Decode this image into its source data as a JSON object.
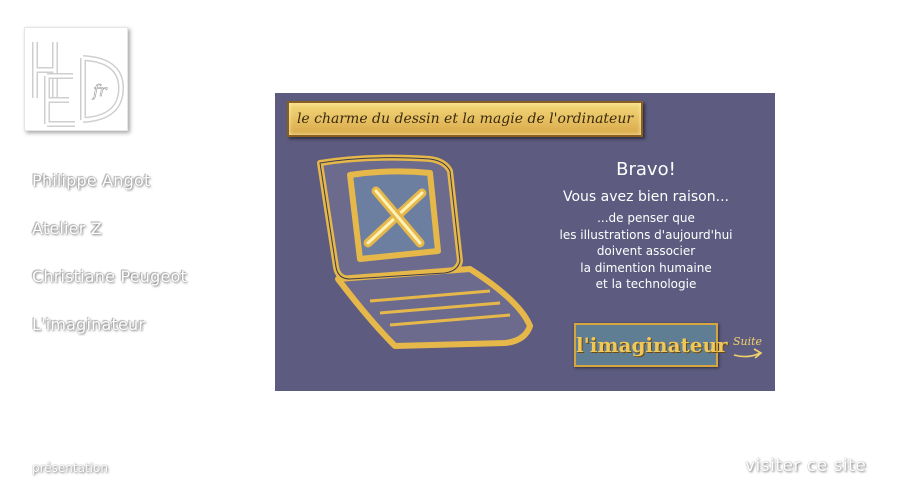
{
  "logo": {
    "letters": "HED",
    "suffix": "fr"
  },
  "nav": {
    "items": [
      {
        "label": "Philippe Angot"
      },
      {
        "label": "Atelier Z"
      },
      {
        "label": "Christiane Peugeot"
      },
      {
        "label": "L'imaginateur"
      }
    ]
  },
  "banner": {
    "tagline": "le charme du dessin et la magie de l'ordinateur",
    "headline": "Bravo!",
    "subheadline": "Vous avez bien raison...",
    "lines": [
      "...de penser que",
      "les illustrations d'aujourd'hui",
      "doivent associer",
      "la dimention humaine",
      "et la technologie"
    ],
    "brand": "l'imaginateur",
    "next": "Suite",
    "colors": {
      "background": "#5d5c80",
      "gold": "#e6b84a"
    }
  },
  "footer": {
    "presentation": "présentation",
    "visit": "visiter ce site"
  }
}
